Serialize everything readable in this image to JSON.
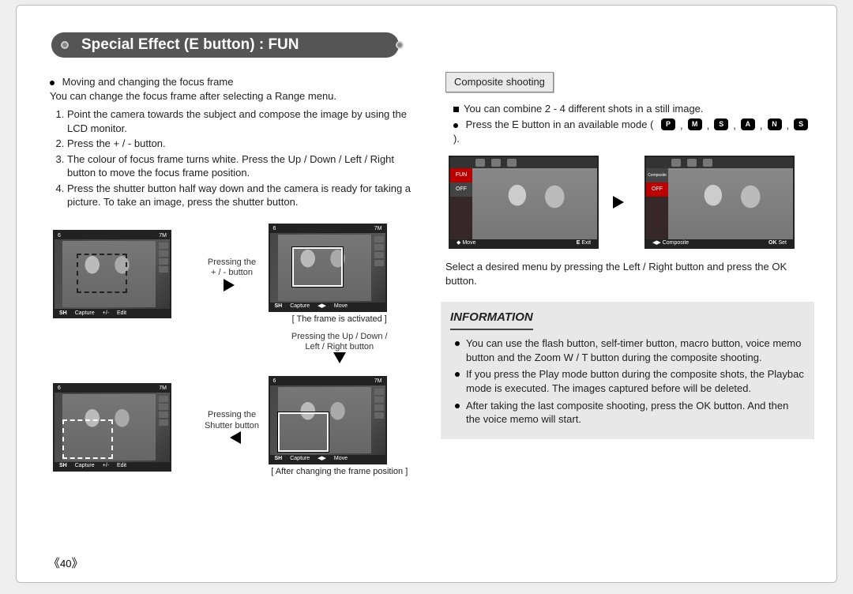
{
  "title": "Special Effect (E button) : FUN",
  "page_number": "40",
  "left": {
    "lead_title": "Moving and changing the focus frame",
    "lead_sub": "You can change the focus frame after selecting a Range menu.",
    "steps": [
      "Point the camera towards the subject and compose the image by using the LCD monitor.",
      "Press the + / - button.",
      "The colour of focus frame turns white. Press the Up / Down / Left / Right button to move the focus frame position.",
      "Press the shutter button half way down and the camera is ready for taking a picture. To take an image, press the shutter button."
    ],
    "lcd": {
      "top_count": "6",
      "top_res": "7M",
      "sh_label": "SH",
      "capture_label": "Capture",
      "edit_label": "Edit",
      "move_label": "Move"
    },
    "mid1": "Pressing the\n+ / - button",
    "caption_b": "[ The frame is activated ]",
    "mid2": "Pressing the Up / Down /\nLeft / Right button",
    "mid3": "Pressing the\nShutter button",
    "caption_c": "[ After changing the frame position ]"
  },
  "right": {
    "sub_tab": "Composite shooting",
    "line1": "You can combine 2 - 4 different shots in a still image.",
    "line2": "Press the E button in an available mode (",
    "line2_end": ").",
    "mode_icons": [
      "P",
      "M",
      "S",
      "A",
      "N",
      "S"
    ],
    "comp_left_menu": [
      "FUN",
      "OFF"
    ],
    "comp_right_menu": [
      "Composite",
      "OFF"
    ],
    "comp_left_bottom_a": "Move",
    "comp_left_bottom_b_k": "E",
    "comp_left_bottom_b": "Exit",
    "comp_right_bottom_a": "Composite",
    "comp_right_bottom_b_k": "OK",
    "comp_right_bottom_b": "Set",
    "after_comp": "Select a desired menu by pressing the Left / Right button and press the OK button.",
    "info_header": "INFORMATION",
    "info_items": [
      "You can use the flash button, self-timer button, macro button, voice memo button and the Zoom W / T button during the composite shooting.",
      "If you press the Play mode button during the composite shots, the Playbac mode is executed. The images captured before will be deleted.",
      "After taking the last composite shooting, press the OK button. And then the voice memo will start."
    ]
  }
}
